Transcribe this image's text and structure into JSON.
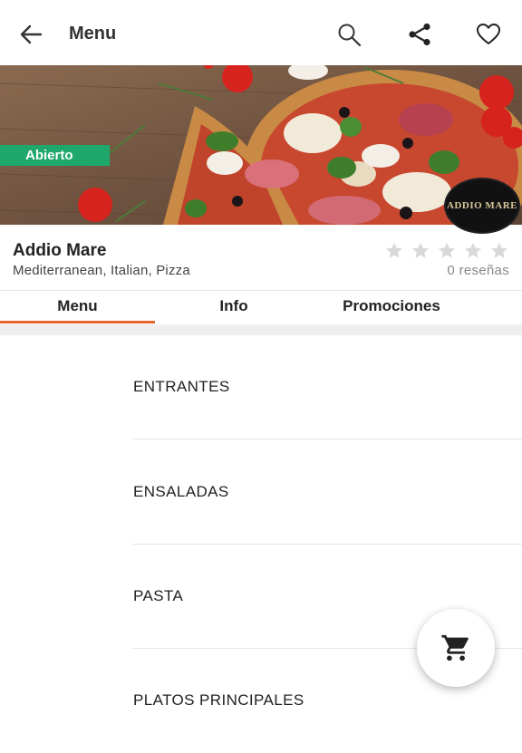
{
  "appbar": {
    "title": "Menu",
    "icons": [
      "back-arrow-icon",
      "search-icon",
      "share-icon",
      "heart-icon"
    ]
  },
  "hero": {
    "status_badge": "Abierto",
    "logo_text": "ADDIO MARE",
    "colors": {
      "badge": "#1ea86b"
    }
  },
  "restaurant": {
    "name": "Addio Mare",
    "cuisine": "Mediterranean, Italian, Pizza",
    "rating_stars_filled": 0,
    "rating_stars_total": 5,
    "reviews": "0 reseñas"
  },
  "tabs": [
    {
      "label": "Menu",
      "active": true
    },
    {
      "label": "Info",
      "active": false
    },
    {
      "label": "Promociones",
      "active": false
    }
  ],
  "accent_color": "#e8622a",
  "categories": [
    {
      "label": "ENTRANTES"
    },
    {
      "label": "ENSALADAS"
    },
    {
      "label": "PASTA"
    },
    {
      "label": "PLATOS PRINCIPALES"
    }
  ],
  "fab": {
    "icon": "shopping-cart-icon"
  }
}
